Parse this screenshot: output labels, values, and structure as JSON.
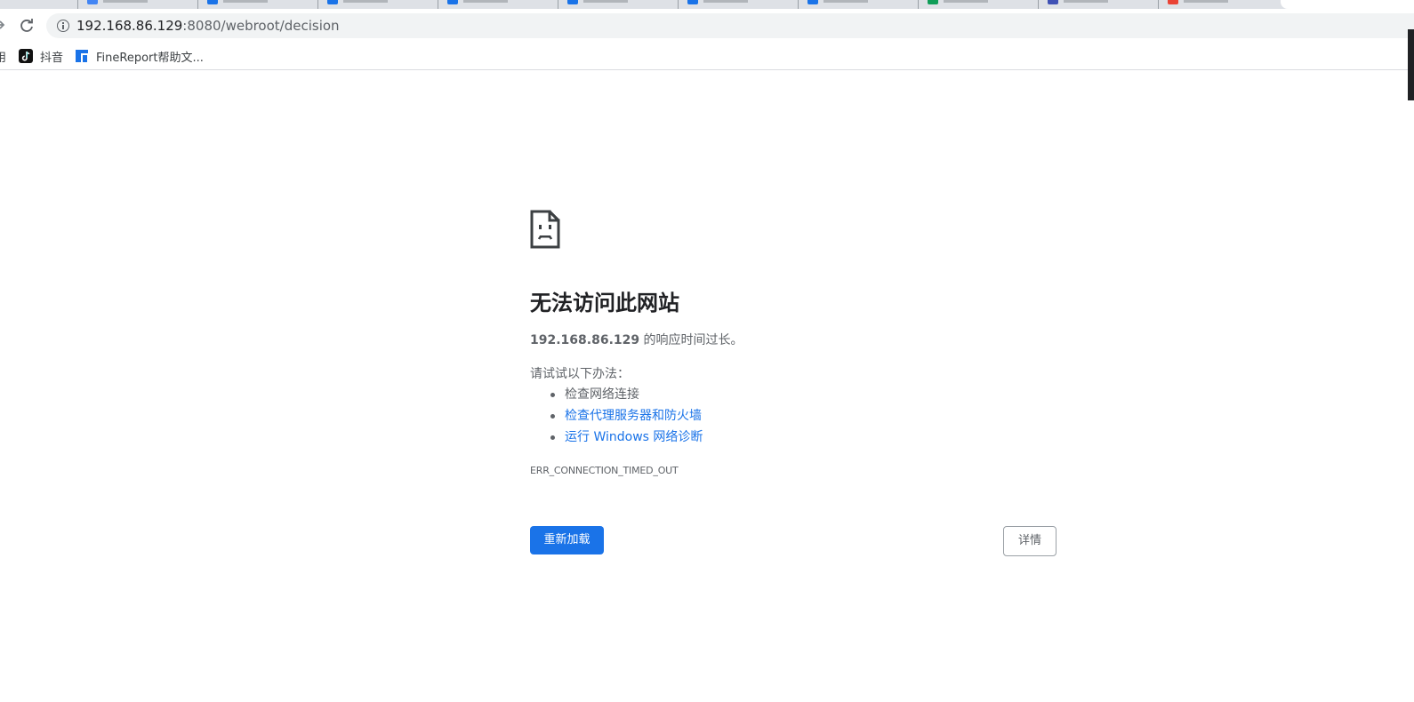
{
  "browser": {
    "url_host": "192.168.86.129",
    "url_rest": ":8080/webroot/decision",
    "bookmarks": [
      {
        "label": "用",
        "icon": "apps-icon"
      },
      {
        "label": "抖音",
        "icon": "douyin-icon"
      },
      {
        "label": "FineReport帮助文...",
        "icon": "finereport-icon"
      }
    ]
  },
  "error_page": {
    "title": "无法访问此网站",
    "host": "192.168.86.129",
    "summary_suffix": " 的响应时间过长。",
    "try_label": "请试试以下办法：",
    "suggestions": [
      "检查网络连接",
      "检查代理服务器和防火墙",
      "运行 Windows 网络诊断"
    ],
    "error_code": "ERR_CONNECTION_TIMED_OUT",
    "reload_button": "重新加载",
    "details_button": "详情"
  },
  "colors": {
    "primary": "#1a73e8",
    "text": "#202124",
    "secondary_text": "#5f6368"
  }
}
